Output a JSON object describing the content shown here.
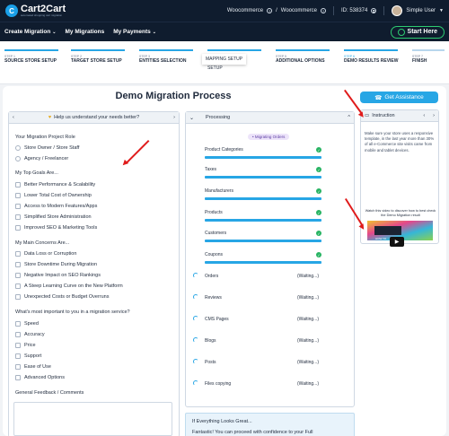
{
  "header": {
    "logo_name": "Cart2Cart",
    "logo_tagline": "automated shopping cart migration",
    "migration_route": "Woocommerce",
    "migration_route_target": "Woocommerce",
    "id_label": "ID: 538374",
    "user_name": "Simple User"
  },
  "nav": {
    "items": [
      "Create Migration",
      "My Migrations",
      "My Payments"
    ],
    "start_label": "Start Here"
  },
  "steps": [
    {
      "num": "STEP 1",
      "label": "SOURCE STORE SETUP"
    },
    {
      "num": "STEP 2",
      "label": "TARGET STORE SETUP"
    },
    {
      "num": "STEP 3",
      "label": "ENTITIES SELECTION"
    },
    {
      "num": "STEP 4",
      "label": "MAPPING SETUP"
    },
    {
      "num": "STEP 5",
      "label": "ADDITIONAL OPTIONS"
    },
    {
      "num": "STEP 6",
      "label": "DEMO RESULTS REVIEW"
    },
    {
      "num": "STEP 7",
      "label": "FINISH"
    }
  ],
  "mapping_chip": "MAPPING SETUP",
  "mapping_sub": "SETUP",
  "page": {
    "title": "Demo Migration Process",
    "assist_label": "Get Assistance"
  },
  "survey": {
    "header": "Help us understand your needs better?",
    "sec_role": "Your Migration Project Role",
    "roles": [
      "Store Owner / Store Staff",
      "Agency / Freelancer"
    ],
    "sec_goals": "My Top Goals Are...",
    "goals": [
      "Better Performance & Scalability",
      "Lower Total Cost of Ownership",
      "Access to Modern Features/Apps",
      "Simplified Store Administration",
      "Improved SEO & Marketing Tools"
    ],
    "sec_concerns": "My Main Concerns Are...",
    "concerns": [
      "Data Loss or Corruption",
      "Store Downtime During Migration",
      "Negative Impact on SEO Rankings",
      "A Steep Learning Curve on the New Platform",
      "Unexpected Costs or Budget Overruns"
    ],
    "sec_important": "What's most important to you in a migration service?",
    "important": [
      "Speed",
      "Accuracy",
      "Price",
      "Support",
      "Ease of Use",
      "Advanced Options"
    ],
    "sec_feedback": "General Feedback / Comments"
  },
  "processing": {
    "header": "Processing",
    "badge": "Migrating Orders",
    "done": [
      "Product Categories",
      "Taxes",
      "Manufacturers",
      "Products",
      "Customers",
      "Coupons"
    ],
    "waiting": [
      "Orders",
      "Reviews",
      "CMS Pages",
      "Blogs",
      "Posts",
      "Files copying"
    ],
    "waiting_label": "(Waiting...)"
  },
  "instruction": {
    "title": "Instruction",
    "text": "Make sure your store uses a responsive template, in the last year more than 30% of all e-Commerce site visits came from mobile and tablet devices.",
    "video_caption": "Watch this video to discover how to best check the Demo Migration result",
    "video_overlay": "HOW TO CHECK DEMO RESULTS"
  },
  "banner": {
    "title": "If Everything Looks Great...",
    "text": "Fantastic! You can proceed with confidence to your Full"
  },
  "colors": {
    "accent": "#27a6e5",
    "nav_bg": "#0f1c2e",
    "success": "#28b463",
    "start_green": "#2ecc71"
  }
}
